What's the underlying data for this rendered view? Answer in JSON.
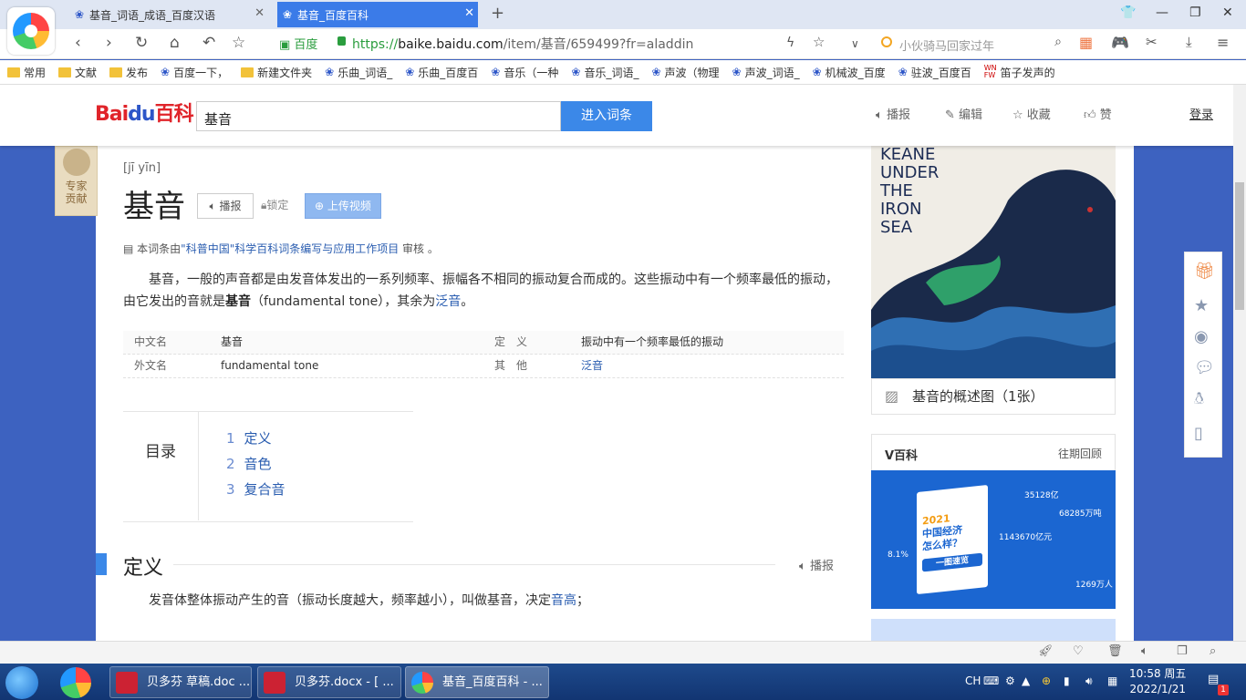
{
  "browser": {
    "tabs": [
      {
        "title": "基音_词语_成语_百度汉语"
      },
      {
        "title": "基音_百度百科"
      }
    ],
    "address": {
      "badge": "百度",
      "url_prefix": "https://",
      "url_host": "baike.baidu.com",
      "url_path": "/item/基音/659499?fr=aladdin"
    },
    "search_placeholder": "小伙骑马回家过年",
    "bookmarks": [
      "常用",
      "文献",
      "发布",
      "百度一下，",
      "新建文件夹",
      "乐曲_词语_",
      "乐曲_百度百",
      "音乐（一种",
      "音乐_词语_",
      "声波（物理",
      "声波_词语_",
      "机械波_百度",
      "驻波_百度百",
      "笛子发声的"
    ]
  },
  "baike": {
    "logo": {
      "a": "Bai",
      "b": "du",
      "c": "百科"
    },
    "search_value": "基音",
    "search_button": "进入词条",
    "actions": [
      "播报",
      "编辑",
      "收藏",
      "赞"
    ],
    "login": "登录",
    "expert": [
      "专家",
      "贡献"
    ],
    "pinyin": "[jī yīn]",
    "title": "基音",
    "broadcast": "播报",
    "locked": "锁定",
    "upload_video": "上传视频",
    "review": {
      "pre": "本词条由",
      "link": "\"科普中国\"科学百科词条编写与应用工作项目",
      "post": " 审核 。"
    },
    "intro": {
      "p1": "基音，一般的声音都是由发音体发出的一系列频率、振幅各不相同的振动复合而成的。这些振动中有一个频率最低的振动，由它发出的音就是",
      "bold": "基音",
      "p2": "（fundamental tone），其余为",
      "link": "泛音",
      "end": "。"
    },
    "info": [
      {
        "l1": "中文名",
        "v1": "基音",
        "l2": "定　义",
        "v2": "振动中有一个频率最低的振动"
      },
      {
        "l1": "外文名",
        "v1": "fundamental tone",
        "l2": "其　他",
        "v2": "泛音"
      }
    ],
    "toc": {
      "label": "目录",
      "items": [
        {
          "n": "1",
          "t": "定义"
        },
        {
          "n": "2",
          "t": "音色"
        },
        {
          "n": "3",
          "t": "复合音"
        }
      ]
    },
    "section": {
      "title": "定义",
      "broadcast": "播报",
      "text": "发音体整体振动产生的音（振动长度越大，频率越小），叫做基音，决定",
      "link": "音高",
      "end": "；"
    },
    "side": {
      "image_text": [
        "KEANE",
        "UNDER",
        "THE",
        "IRON",
        "SEA"
      ],
      "caption": "基音的概述图（1张）",
      "vbaike": "V百科",
      "past": "往期回顾",
      "v_year": "2021",
      "v_title1": "中国经济",
      "v_title2": "怎么样？",
      "v_sub": "一图速览",
      "v_nums": [
        "35128亿",
        "68285万吨",
        "1143670亿元",
        "8.1%",
        "1269万人"
      ]
    }
  },
  "taskbar": {
    "items": [
      "贝多芬 草稿.doc ...",
      "贝多芬.docx - [ ...",
      "基音_百度百科 - ..."
    ],
    "ime": "CH",
    "time": "10:58 周五",
    "date": "2022/1/21",
    "notif": "1"
  },
  "colors": {
    "tab_active": "#3b7be8",
    "baike_button": "#3b88e8",
    "link": "#2a5db0",
    "page_bg": "#3d62c0"
  }
}
